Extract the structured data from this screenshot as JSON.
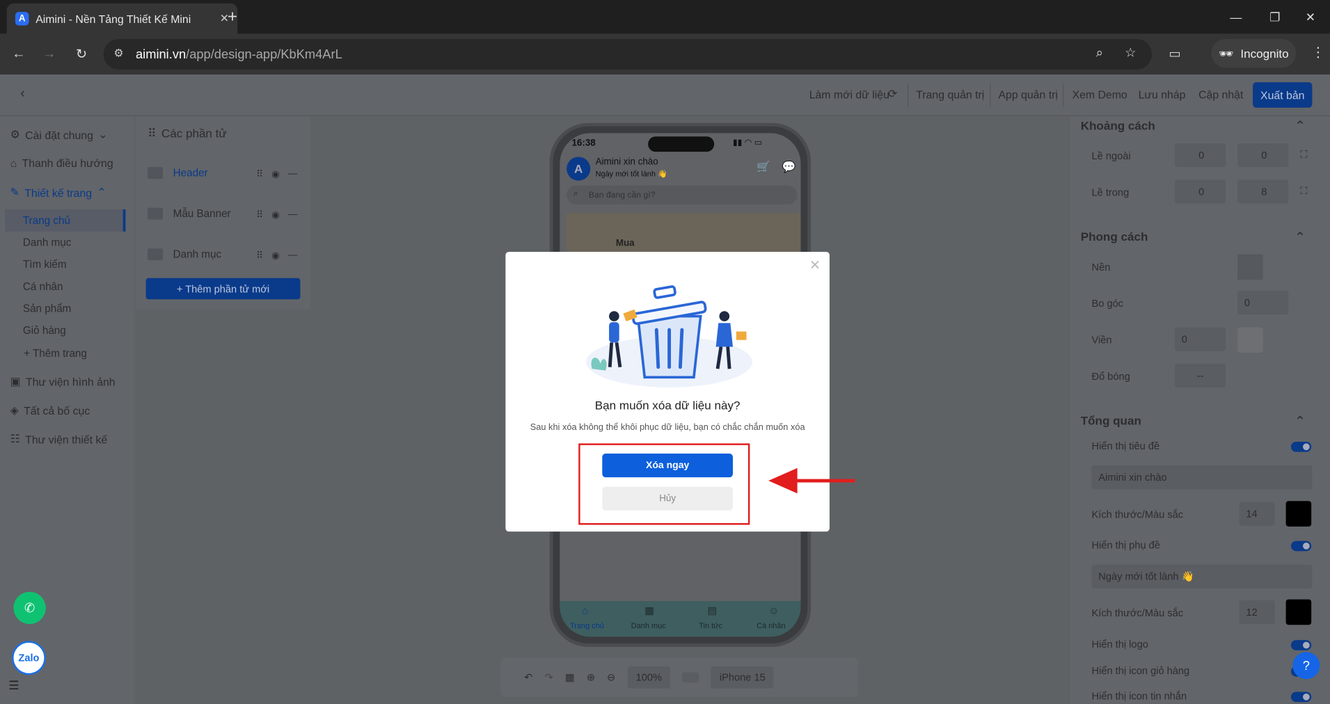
{
  "browser": {
    "tab_title": "Aimini - Nền Tảng Thiết Kế Mini",
    "tab_icon": "A",
    "new_tab": "+",
    "url_host": "aimini.vn",
    "url_path": "/app/design-app/KbKm4ArL",
    "incognito_label": "Incognito"
  },
  "topbar": {
    "refresh": "Làm mới dữ liệu",
    "admin_page": "Trang quản trị",
    "admin_app": "App quản trị",
    "demo": "Xem Demo",
    "save_draft": "Lưu nháp",
    "update": "Cập nhật",
    "publish": "Xuất bản"
  },
  "leftnav": {
    "general": "Cài đặt chung",
    "navbar": "Thanh điều hướng",
    "page_design": "Thiết kế trang",
    "pages": [
      "Trang chủ",
      "Danh mục",
      "Tìm kiếm",
      "Cá nhân",
      "Sản phẩm",
      "Giỏ hàng"
    ],
    "add_page": "+ Thêm trang",
    "images": "Thư viện hình ảnh",
    "layouts": "Tất cả bố cục",
    "design_lib": "Thư viện thiết kế"
  },
  "elements": {
    "title": "Các phần tử",
    "items": [
      "Header",
      "Mẫu Banner",
      "Danh mục"
    ],
    "add": "+ Thêm phần tử mới"
  },
  "phone": {
    "time": "16:38",
    "greeting": "Aimini xin chào",
    "subtitle": "Ngày mới tốt lành 👋",
    "search_placeholder": "Bạn đang cần gì?",
    "banner_text": "Mua",
    "tabs": [
      "Trang chủ",
      "Danh mục",
      "Tin tức",
      "Cá nhân"
    ]
  },
  "toolbar": {
    "zoom": "100%",
    "device": "iPhone 15"
  },
  "rightpanel": {
    "spacing": "Khoảng cách",
    "outer": "Lề ngoài",
    "inner": "Lề trong",
    "outer_v": "0",
    "outer_h": "0",
    "inner_v": "0",
    "inner_h": "8",
    "style": "Phong cách",
    "bg": "Nền",
    "radius": "Bo góc",
    "radius_v": "0",
    "border": "Viền",
    "border_v": "0",
    "shadow": "Đổ bóng",
    "shadow_v": "--",
    "overview": "Tổng quan",
    "show_title": "Hiển thị tiêu đề",
    "title_value": "Aimini xin chào",
    "size_color": "Kích thước/Màu sắc",
    "title_size": "14",
    "show_subtitle": "Hiển thị phụ đề",
    "subtitle_value": "Ngày mới tốt lành 👋",
    "subtitle_size": "12",
    "show_logo": "Hiển thị logo",
    "show_cart_icon": "Hiển thị icon giỏ hàng",
    "show_msg_icon": "Hiển thị icon tin nhắn"
  },
  "modal": {
    "title": "Bạn muốn xóa dữ liệu này?",
    "description": "Sau khi xóa không thể khôi phục dữ liệu, bạn có chắc chắn muốn xóa",
    "confirm": "Xóa ngay",
    "cancel": "Hủy"
  },
  "floating": {
    "zalo": "Zalo",
    "help": "?"
  },
  "colors": {
    "primary": "#0d5fdc",
    "highlight": "#e21d1d",
    "call": "#0fc271"
  }
}
